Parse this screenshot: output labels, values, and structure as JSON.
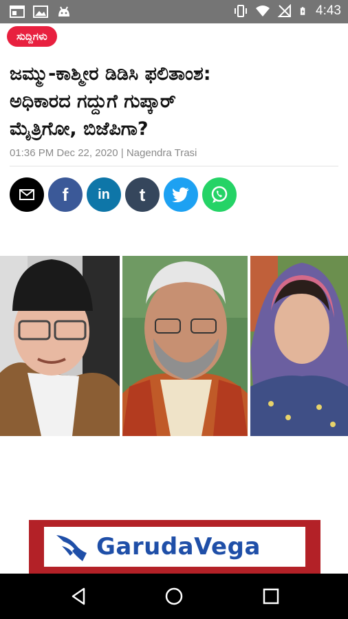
{
  "status_bar": {
    "time": "4:43",
    "left_icons": [
      "browser-window-icon",
      "image-icon",
      "android-icon"
    ],
    "right_icons": [
      "vibrate-icon",
      "wifi-icon",
      "no-signal-icon",
      "battery-icon"
    ]
  },
  "article": {
    "category": "ಸುದ್ದಿಗಳು",
    "headline_lines": [
      "ಜಮ್ಮು-ಕಾಶ್ಮೀರ ಡಿಡಿಸಿ ಫಲಿತಾಂಶ:",
      "ಅಧಿಕಾರದ ಗದ್ದುಗೆ ಗುಪ್ಕಾರ್",
      "ಮೈತ್ರಿಗೋ, ಬಿಜೆಪಿಗಾ?"
    ],
    "byline": "01:36 PM Dec 22, 2020 | Nagendra Trasi"
  },
  "share": [
    {
      "name": "email",
      "glyph": "✉",
      "color": "#000000"
    },
    {
      "name": "facebook",
      "glyph": "f",
      "color": "#3b5998"
    },
    {
      "name": "linkedin",
      "glyph": "in",
      "color": "#0e76a8"
    },
    {
      "name": "tumblr",
      "glyph": "t",
      "color": "#35465c"
    },
    {
      "name": "twitter",
      "glyph": "🐦",
      "color": "#1da1f2"
    },
    {
      "name": "whatsapp",
      "glyph": "✆",
      "color": "#25d366"
    }
  ],
  "ad": {
    "brand": "GarudaVega"
  }
}
